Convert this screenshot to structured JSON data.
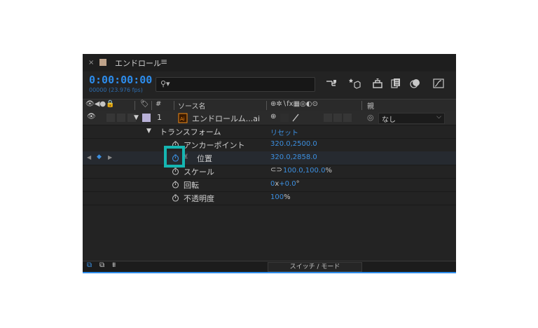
{
  "panel": {
    "tab": {
      "close": "×",
      "title": "エンドロール",
      "menu": "≡",
      "swatch_color": "#bfa38a"
    },
    "timecode": "0:00:00:00",
    "frames": "00000 (23.976 fps)",
    "search": {
      "placeholder": ""
    },
    "toolbar_icons": [
      "comp-flowchart-icon",
      "draft-3d-icon",
      "shy-layers-icon",
      "frame-blending-icon",
      "motion-blur-icon",
      "graph-editor-icon"
    ]
  },
  "columns": {
    "av": "👁◀●🔒",
    "label": "🏷",
    "number": "#",
    "source_name": "ソース名",
    "switches": "⊕✲∖fx▦◎◐⊙",
    "parent": "親"
  },
  "layer": {
    "index": "1",
    "name": "エンドロールム...ai",
    "parent": "なし",
    "label_color": "#b9b1d8"
  },
  "transform": {
    "label": "トランスフォーム",
    "reset": "リセット",
    "properties": [
      {
        "name": "アンカーポイント",
        "value": "320.0,2500.0"
      },
      {
        "name": "位置",
        "value": "320.0,2858.0"
      },
      {
        "name": "スケール",
        "value": "100.0,100.0",
        "unit": "%"
      },
      {
        "name": "回転",
        "value_a": "0",
        "value_a_unit": "x",
        "value_b": "+0.0",
        "value_b_unit": "°"
      },
      {
        "name": "不透明度",
        "value": "100",
        "unit": "%"
      }
    ]
  },
  "footer": {
    "toggle_label": "スイッチ / モード"
  },
  "accent_color": "#2d8ceb",
  "highlight_color": "#16b6b2"
}
